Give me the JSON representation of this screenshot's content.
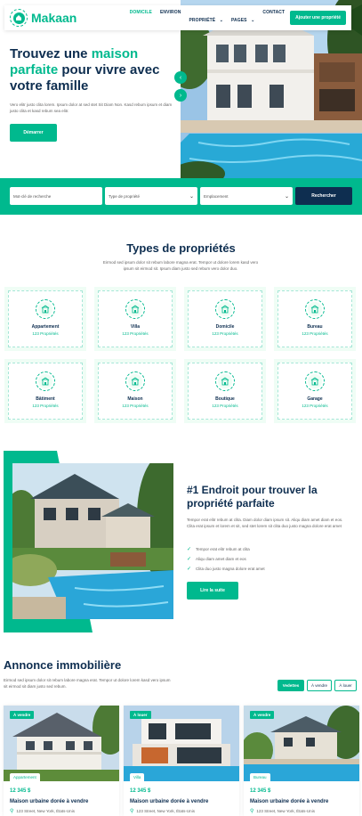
{
  "brand": {
    "name": "Makaan",
    "accent": "#00B98E",
    "dark": "#0E2E50",
    "light_bg": "#EFFDF5"
  },
  "nav": {
    "items": [
      {
        "label": "DOMICILE",
        "active": true
      },
      {
        "label": "ENVIRON",
        "active": false
      },
      {
        "label": "PROPRIÉTÉ",
        "active": false,
        "dropdown": true
      },
      {
        "label": "PAGES",
        "active": false,
        "dropdown": true
      },
      {
        "label": "CONTACT",
        "active": false
      }
    ],
    "cta": "Ajouter une propriété"
  },
  "hero": {
    "title_before": "Trouvez une ",
    "title_accent": "maison parfaite",
    "title_after": " pour vivre avec votre famille",
    "description": "Vero elitr justo clita lorem. Ipsum dolor at sed stet Sit Diam Non. Kasd rebum ipsum et diam justo clita et kasd rebum sea elitr.",
    "button": "Démarrer",
    "prev_icon": "chevron-left-icon",
    "next_icon": "chevron-right-icon"
  },
  "search": {
    "keyword_placeholder": "Mot-clé de recherche",
    "type_placeholder": "Type de propriété",
    "location_placeholder": "Emplacement",
    "button": "Rechercher"
  },
  "types": {
    "title": "Types de propriétés",
    "description": "Eirmod sed ipsum dolor sit rebum labore magna erat. Tempor ut dolore lorem kasd vero ipsum sit eirmod sit. Ipsum diam justo sed rebum vero dolor duo.",
    "items": [
      {
        "name": "Appartement",
        "count": "123 Propriétés",
        "icon": "apartment-icon"
      },
      {
        "name": "Villa",
        "count": "123 Propriétés",
        "icon": "villa-icon"
      },
      {
        "name": "Domicile",
        "count": "123 Propriétés",
        "icon": "house-icon"
      },
      {
        "name": "Bureau",
        "count": "123 Propriétés",
        "icon": "office-icon"
      },
      {
        "name": "Bâtiment",
        "count": "123 Propriétés",
        "icon": "building-icon"
      },
      {
        "name": "Maison",
        "count": "123 Propriétés",
        "icon": "home-icon"
      },
      {
        "name": "Boutique",
        "count": "123 Propriétés",
        "icon": "shop-icon"
      },
      {
        "name": "Garage",
        "count": "123 Propriétés",
        "icon": "garage-icon"
      }
    ]
  },
  "about": {
    "title": "#1 Endroit pour trouver la propriété parfaite",
    "description": "Tempor erat elitr rebum at clita. Diam dolor diam ipsum sit. Aliqu diam amet diam et eos. Clita erat ipsum et lorem et sit, sed stet lorem sit clita duo justo magna dolore erat amet",
    "items": [
      "Tempor erat elitr rebum at clita",
      "Aliqu diam amet diam et eos",
      "Clita duo justo magna dolore erat amet"
    ],
    "button": "Lire la suite"
  },
  "listings": {
    "title": "Annonce immobilière",
    "description": "Eirmod sed ipsum dolor sit rebum labore magna erat. Tempor ut dolore lorem kasd vero ipsum sit eirmod sit diam justo sed rebum.",
    "filters": [
      {
        "label": "Vedettes",
        "active": true
      },
      {
        "label": "À vendre",
        "active": false
      },
      {
        "label": "À louer",
        "active": false
      }
    ],
    "cards": [
      {
        "status": "À vendre",
        "type": "Appartement",
        "price": "12 345 $",
        "name": "Maison urbaine dorée à vendre",
        "address": "123 Street, New York, États-Unis"
      },
      {
        "status": "À louer",
        "type": "Villa",
        "price": "12 345 $",
        "name": "Maison urbaine dorée à vendre",
        "address": "123 Street, New York, États-Unis"
      },
      {
        "status": "À vendre",
        "type": "Bureau",
        "price": "12 345 $",
        "name": "Maison urbaine dorée à vendre",
        "address": "123 Street, New York, États-Unis"
      }
    ]
  }
}
